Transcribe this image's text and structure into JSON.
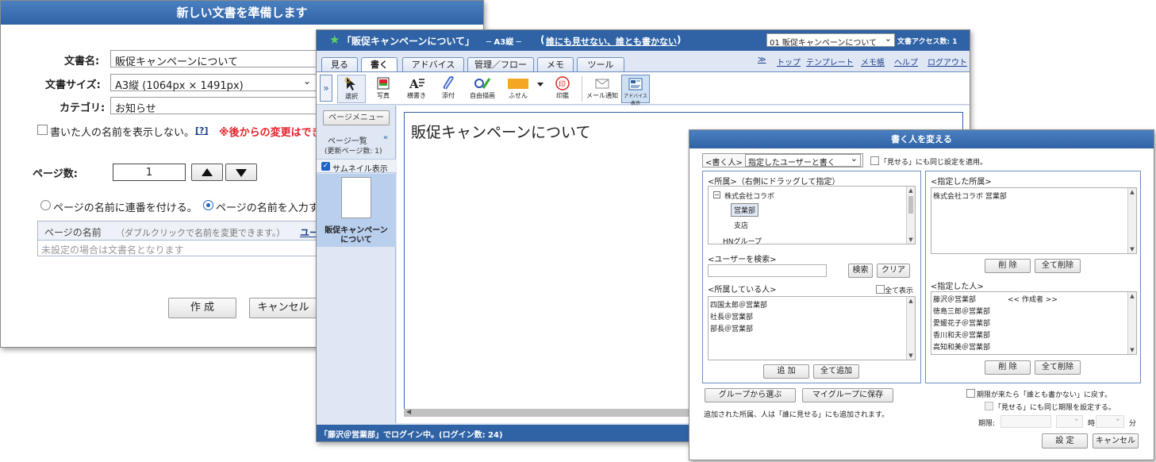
{
  "new_doc": {
    "title": "新しい文書を準備します",
    "name_label": "文書名:",
    "name_value": "販促キャンペーンについて",
    "size_label": "文書サイズ:",
    "size_value": "A3縦 (1064px × 1491px)",
    "category_label": "カテゴリ:",
    "category_value": "お知らせ",
    "hide_author": "書いた人の名前を表示しない。",
    "help": "[?]",
    "warning": "※後からの変更はでき",
    "pages_label": "ページ数:",
    "pages_value": "1",
    "radio_serial": "ページの名前に連番を付ける。",
    "radio_input": "ページの名前を入力す",
    "table_header": "ページの名前",
    "table_hint": "（ダブルクリックで名前を変更できます。）",
    "table_link": "ユー",
    "table_placeholder": "未設定の場合は文書名となります",
    "create_btn": "作 成",
    "cancel_btn": "キャンセル"
  },
  "editor": {
    "star": "★",
    "title": "「販促キャンペーンについて」",
    "size": "─ A3縦 ─",
    "access_paren_open": "(",
    "access_link": "誰にも見せない、誰とも書かない",
    "access_paren_close": ")",
    "doc_select": "01 販促キャンペーンについて",
    "access_count": "文書アクセス数: 1",
    "tabs": [
      "見る",
      "書く",
      "アドバイス",
      "管理／フロー",
      "メモ",
      "ツール"
    ],
    "nav_prefix": "≫",
    "nav_links": [
      "トップ",
      "テンプレート",
      "メモ帳",
      "ヘルプ",
      "ログアウト"
    ],
    "tools": [
      "選択",
      "写真",
      "横書き",
      "添付",
      "自由描画",
      "ふせん",
      "印鑑",
      "メール通知",
      "アドバイス表示"
    ],
    "page_menu": "ページメニュー",
    "page_list": "ページ一覧",
    "updated_pages": "(更新ページ数: 1)",
    "thumbnail": "サムネイル表示",
    "thumb_caption_1": "販促キャンペーン",
    "thumb_caption_2": "について",
    "content_text": "販促キャンペーンについて",
    "status": "「藤沢＠営業部」でログイン中。(ログイン数: 24)"
  },
  "writers": {
    "title": "書く人を変える",
    "writer_label": "<書く人>",
    "writer_select": "指定したユーザーと書く",
    "same_setting": "「見せる」にも同じ設定を適用。",
    "dept_header": "<所属>（右側にドラッグして指定）",
    "tree": [
      "株式会社コラボ",
      "営業部",
      "支店",
      "HNグループ"
    ],
    "selected_dept_header": "<指定した所属>",
    "selected_dept_items": [
      "株式会社コラボ 営業部"
    ],
    "search_header": "<ユーザーを検索>",
    "search_btn": "検索",
    "clear_btn": "クリア",
    "members_header": "<所属している人>",
    "show_all": "全て表示",
    "members": [
      "四国太郎＠営業部",
      "社長＠営業部",
      "部長＠営業部"
    ],
    "add_btn": "追 加",
    "add_all_btn": "全て追加",
    "delete_btn": "削 除",
    "delete_all_btn": "全て削除",
    "selected_people_header": "<指定した人>",
    "selected_people": [
      "藤沢＠営業部",
      "徳島三郎＠営業部",
      "愛媛花子＠営業部",
      "香川和夫＠営業部",
      "高知和美＠営業部"
    ],
    "creator_tag": "<< 作成者 >>",
    "group_select_btn": "グループから選ぶ",
    "save_group_btn": "マイグループに保存",
    "note": "追加された所属、人は「誰に見せる」にも追加されます。",
    "expire_revert": "期限が来たら「誰とも書かない」に戻す。",
    "expire_same": "「見せる」にも同じ期限を設定する。",
    "deadline_label": "期限:",
    "hour_label": "時",
    "minute_label": "分",
    "ok_btn": "設 定",
    "cancel_btn": "キャンセル"
  }
}
